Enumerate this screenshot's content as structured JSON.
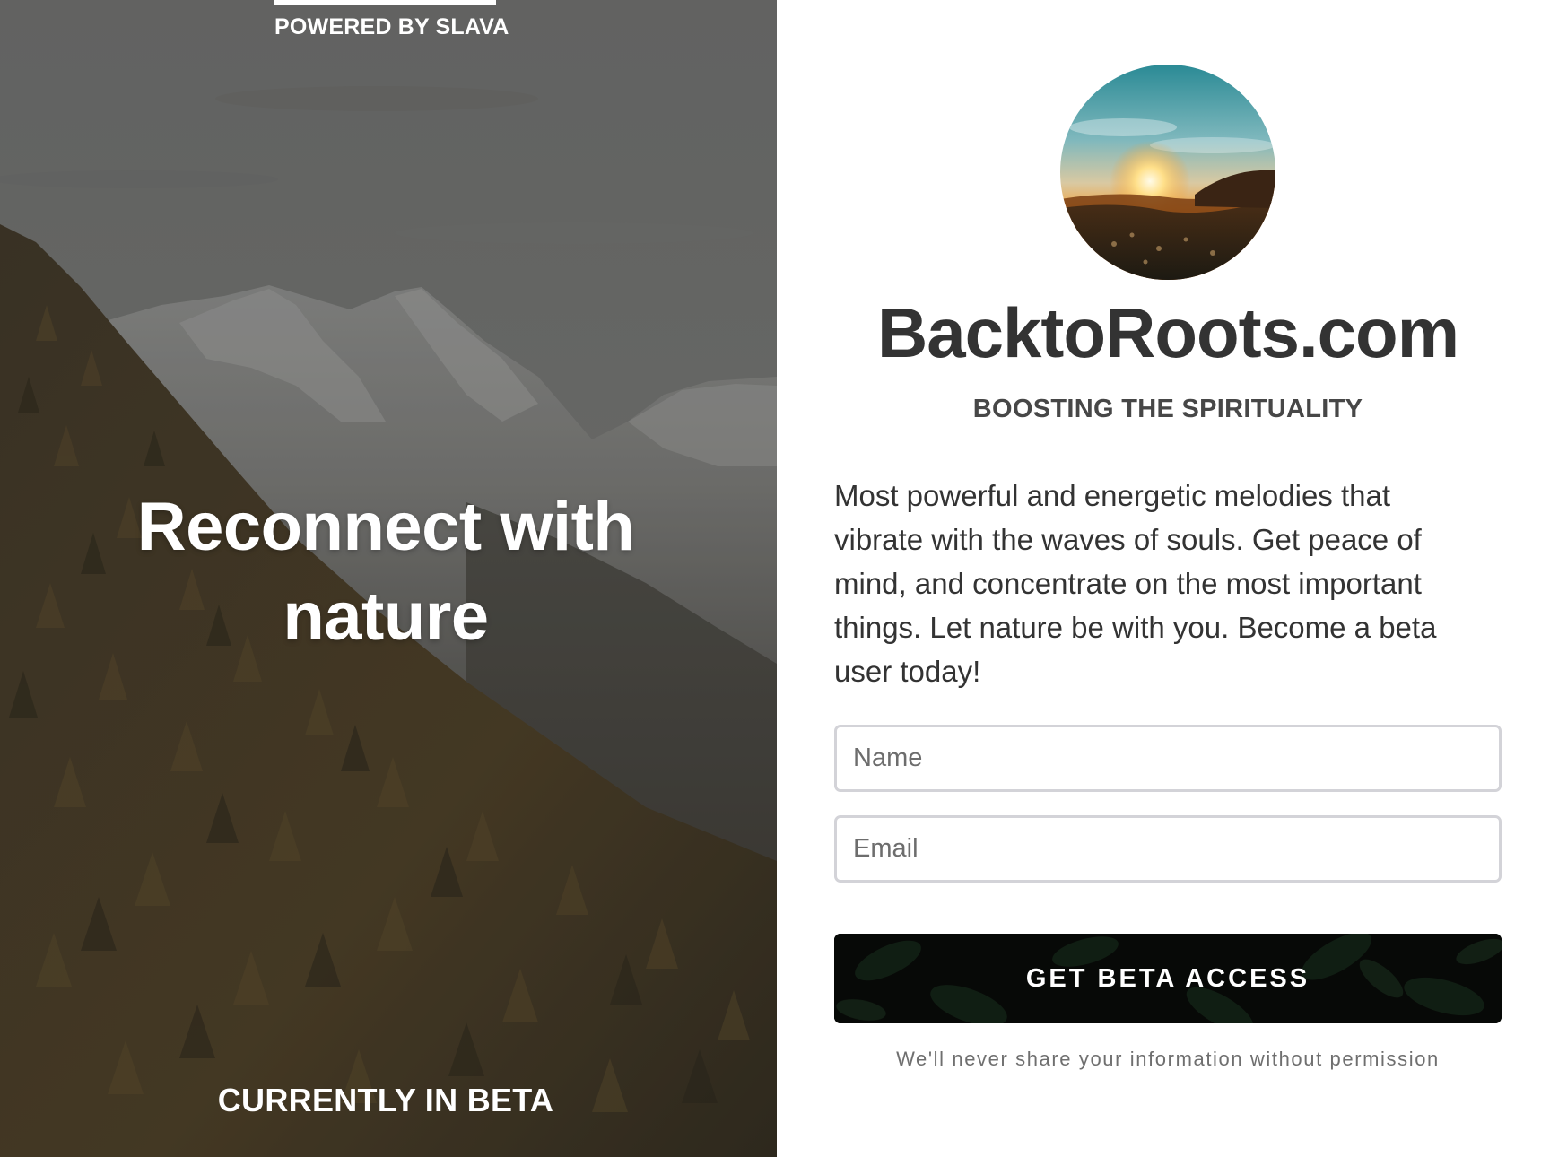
{
  "hero": {
    "powered_by": "POWERED BY SLAVA",
    "headline": "Reconnect with nature",
    "status": "CURRENTLY IN BETA"
  },
  "signup": {
    "brand": "BacktoRoots.com",
    "tagline": "BOOSTING THE SPIRITUALITY",
    "description": "Most powerful and energetic melodies that vibrate with the waves of souls. Get peace of mind, and concentrate on the most important things. Let nature be with you. Become a beta user today!",
    "name_placeholder": "Name",
    "email_placeholder": "Email",
    "cta_label": "GET BETA ACCESS",
    "privacy_note": "We'll never share your information without permission"
  },
  "icons": {
    "avatar": "sunset-avatar-image",
    "hero_background": "mountain-forest-photo"
  },
  "colors": {
    "text_dark": "#333333",
    "tagline": "#474747",
    "input_border": "#d3d3d8",
    "button_bg": "#0b0d0b",
    "privacy_text": "#6f6f6f",
    "hero_text": "#ffffff"
  }
}
